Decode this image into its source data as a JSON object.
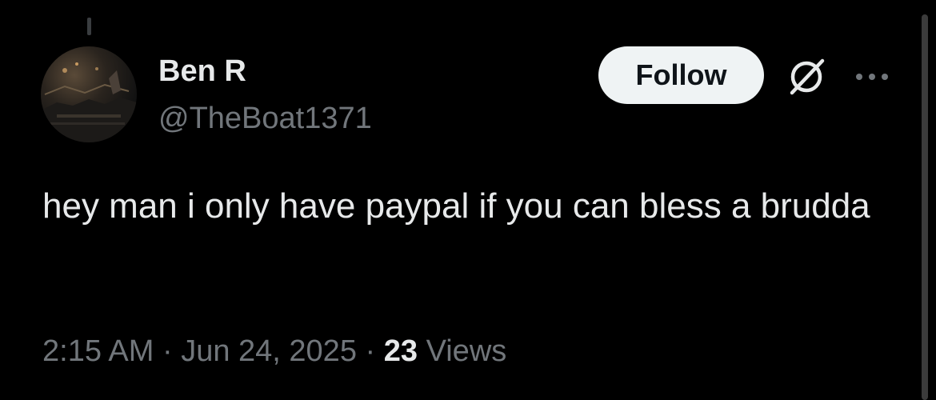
{
  "author": {
    "name": "Ben R",
    "handle": "@TheBoat1371"
  },
  "actions": {
    "follow_label": "Follow",
    "grok_icon": "grok-icon",
    "more_icon": "more-icon"
  },
  "tweet": {
    "text": "hey man i only have paypal if you can bless a brudda",
    "time": "2:15 AM",
    "separator": "·",
    "date": "Jun 24, 2025",
    "views_count": "23",
    "views_label": "Views"
  },
  "colors": {
    "background": "#000000",
    "primary_text": "#e7e9ea",
    "secondary_text": "#71767b",
    "follow_bg": "#eff3f4",
    "follow_text": "#0f1419"
  }
}
